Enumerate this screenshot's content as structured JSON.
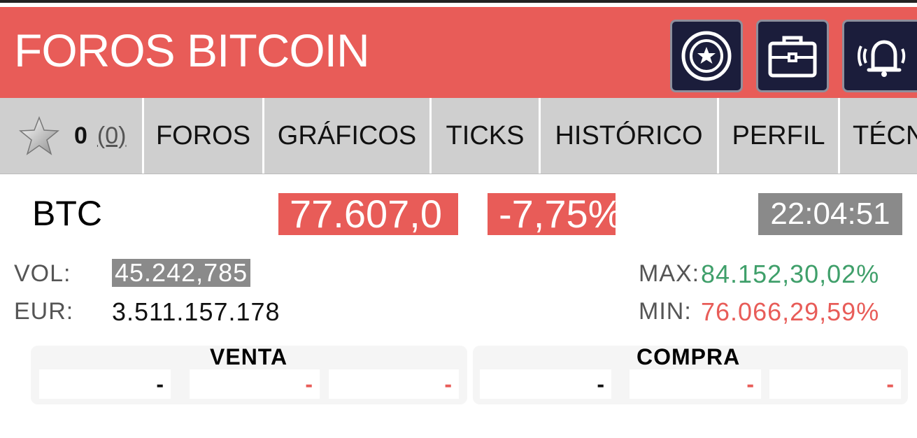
{
  "header": {
    "title": "FOROS BITCOIN",
    "buttons": [
      {
        "icon": "star-coin-icon"
      },
      {
        "icon": "briefcase-icon"
      },
      {
        "icon": "bell-icon"
      }
    ],
    "colors": {
      "background": "#e85c58",
      "button_bg": "#1b1d3b"
    }
  },
  "tabs": {
    "favorites": {
      "count": "0",
      "paren": "(0)",
      "icon": "star-icon"
    },
    "items": [
      "FOROS",
      "GRÁFICOS",
      "TICKS",
      "HISTÓRICO",
      "PERFIL",
      "TÉCN"
    ]
  },
  "quote": {
    "symbol": "BTC",
    "price": "77.607,0",
    "change": "-7,75%",
    "time": "22:04:51",
    "vol_label": "VOL:",
    "vol_value": "45.242,785",
    "eur_label": "EUR:",
    "eur_value": "3.511.157.178",
    "max_label": "MAX:",
    "max_value": "84.152,30,02%",
    "min_label": "MIN:",
    "min_value": "76.066,29,59%"
  },
  "orderbook": {
    "sell": {
      "title": "VENTA",
      "cells": [
        "-",
        "-",
        "-"
      ]
    },
    "buy": {
      "title": "COMPRA",
      "cells": [
        "-",
        "-",
        "-"
      ]
    }
  },
  "colors": {
    "positive": "#3f9f6a",
    "negative": "#e85c58",
    "neutral_box": "#8a8a8a"
  }
}
